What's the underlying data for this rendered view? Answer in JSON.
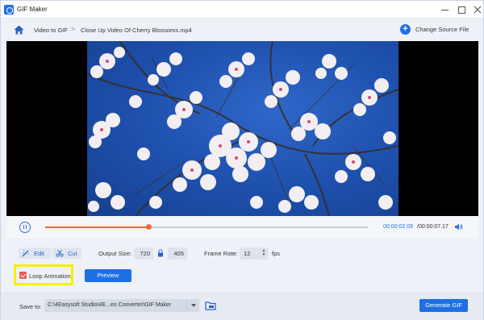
{
  "window": {
    "title": "GIF Maker"
  },
  "breadcrumb": {
    "items": [
      "Video to GIF",
      "Close Up Video Of Cherry Blossoms.mp4"
    ],
    "separator": ">",
    "change_source_label": "Change Source File"
  },
  "player": {
    "progress": 0.32,
    "current_time": "00:00:02.09",
    "total_time": "/00:00:07.17"
  },
  "tools": {
    "edit_label": "Edit",
    "cut_label": "Cut"
  },
  "output_size": {
    "label": "Output Size:",
    "width": "720",
    "height": "405"
  },
  "frame_rate": {
    "label": "Frame Rate:",
    "value": "12",
    "unit": "fps"
  },
  "loop": {
    "label": "Loop Animation",
    "checked": true
  },
  "preview_label": "Preview",
  "save": {
    "label": "Save to:",
    "path": "C:\\4Easysoft Studio\\4E...eo Converter\\GIF Maker"
  },
  "generate_label": "Generate GIF",
  "colors": {
    "accent": "#1f6fe5",
    "progress": "#f0683a",
    "highlight": "#f5f000",
    "checkbox": "#ec5a4d"
  },
  "icons": [
    "app-logo-icon",
    "home-icon",
    "plus-icon",
    "pause-icon",
    "volume-icon",
    "edit-icon",
    "scissors-icon",
    "lock-icon",
    "folder-icon",
    "chevron-down-icon"
  ]
}
